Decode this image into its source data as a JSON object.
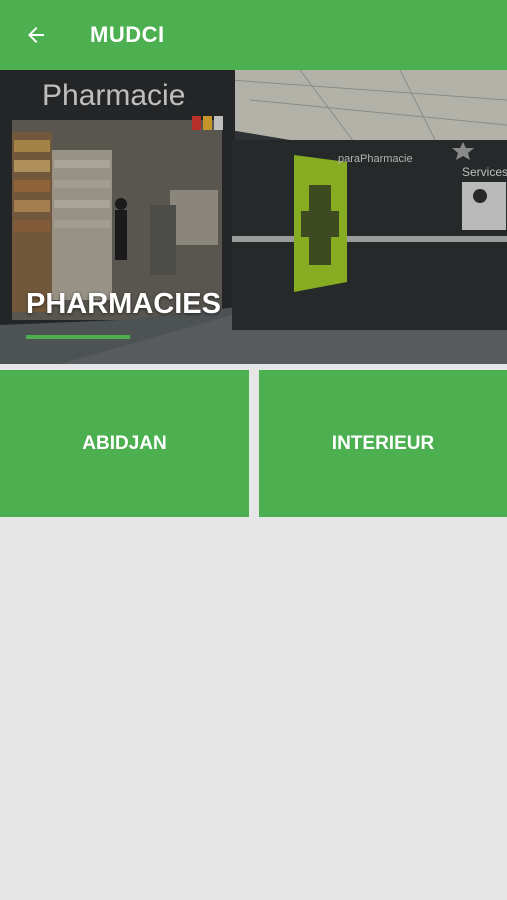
{
  "appbar": {
    "title": "MUDCI",
    "back_icon": "arrow-left-icon"
  },
  "hero": {
    "title": "PHARMACIES",
    "image_sign": "Pharmacie",
    "image_sign_small": "paraPharmacie",
    "image_sign_services": "Services"
  },
  "tiles": [
    {
      "label": "ABIDJAN"
    },
    {
      "label": "INTERIEUR"
    }
  ],
  "colors": {
    "primary": "#4caf50",
    "background": "#e6e6e6"
  }
}
